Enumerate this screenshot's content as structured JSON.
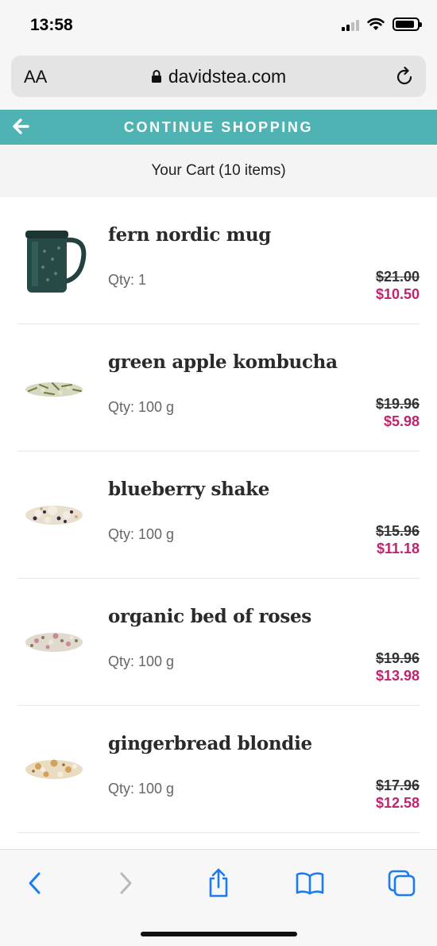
{
  "status_bar": {
    "time": "13:58",
    "battery_level": 0.9
  },
  "browser": {
    "text_size_label": "AA",
    "url": "davidstea.com"
  },
  "nav": {
    "continue_label": "CONTINUE SHOPPING"
  },
  "cart": {
    "title": "Your Cart (10 items)",
    "items": [
      {
        "name": "fern nordic mug",
        "qty": "Qty: 1",
        "old_price": "$21.00",
        "new_price": "$10.50",
        "thumb": "mug"
      },
      {
        "name": "green apple kombucha",
        "qty": "Qty: 100 g",
        "old_price": "$19.96",
        "new_price": "$5.98",
        "thumb": "green-tea"
      },
      {
        "name": "blueberry shake",
        "qty": "Qty: 100 g",
        "old_price": "$15.96",
        "new_price": "$11.18",
        "thumb": "blueberry-blend"
      },
      {
        "name": "organic bed of roses",
        "qty": "Qty: 100 g",
        "old_price": "$19.96",
        "new_price": "$13.98",
        "thumb": "rose-blend"
      },
      {
        "name": "gingerbread blondie",
        "qty": "Qty: 100 g",
        "old_price": "$17.96",
        "new_price": "$12.58",
        "thumb": "gingerbread-blend"
      }
    ]
  },
  "colors": {
    "accent": "#4fb2b3",
    "sale_price": "#c0246e",
    "toolbar_icon": "#1a7cf0"
  },
  "toolbar": {
    "icons": [
      "back-icon",
      "forward-icon",
      "share-icon",
      "bookmarks-icon",
      "tabs-icon"
    ]
  }
}
